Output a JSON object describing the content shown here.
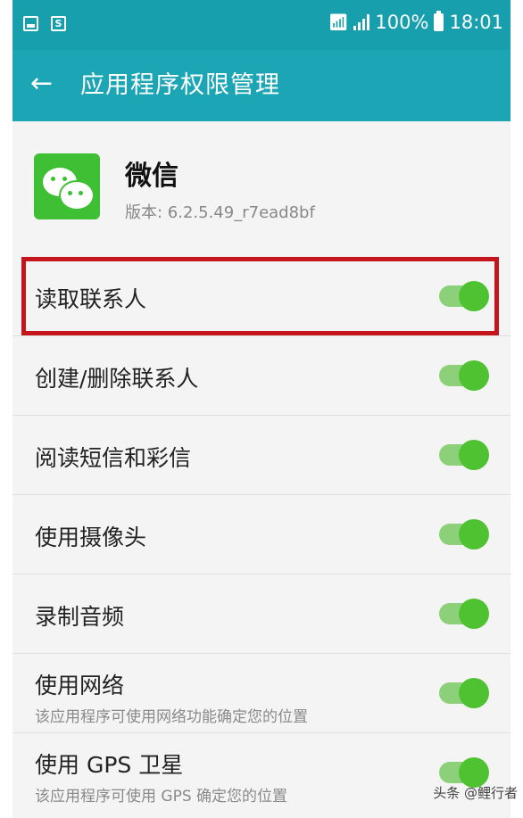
{
  "status_bar": {
    "battery": "100%",
    "time": "18:01",
    "icons": [
      "image-icon",
      "notification-s-icon",
      "wifi-icon",
      "signal-icon",
      "battery-icon"
    ]
  },
  "app_bar": {
    "title": "应用程序权限管理",
    "back_icon": "back-arrow-icon",
    "color": "#1ca5b4"
  },
  "app": {
    "name": "微信",
    "version": "版本: 6.2.5.49_r7ead8bf",
    "icon": "wechat-icon"
  },
  "permissions": [
    {
      "label": "读取联系人",
      "enabled": true,
      "highlighted": true
    },
    {
      "label": "创建/删除联系人",
      "enabled": true
    },
    {
      "label": "阅读短信和彩信",
      "enabled": true
    },
    {
      "label": "使用摄像头",
      "enabled": true
    },
    {
      "label": "录制音频",
      "enabled": true
    },
    {
      "label": "使用网络",
      "description": "该应用程序可使用网络功能确定您的位置",
      "enabled": true
    },
    {
      "label": "使用 GPS 卫星",
      "description": "该应用程序可使用 GPS 确定您的位置",
      "enabled": true
    }
  ],
  "watermark": "头条 @鲤行者",
  "colors": {
    "accent": "#1ca5b4",
    "toggle_on": "#4fc232",
    "highlight": "#c5151c"
  }
}
